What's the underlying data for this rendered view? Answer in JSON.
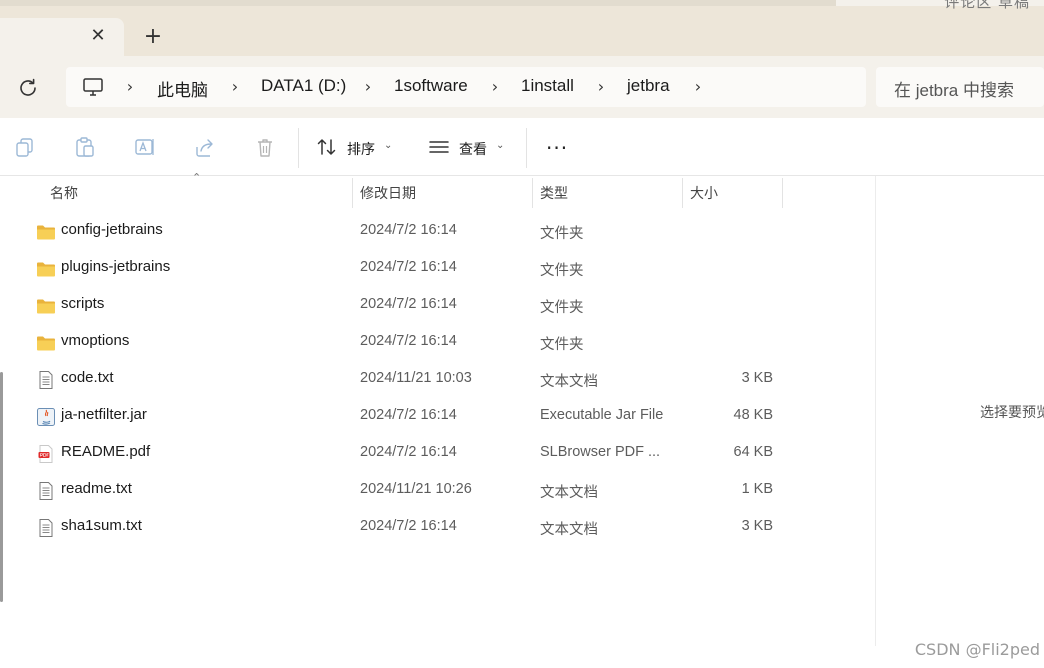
{
  "titlebar": {
    "corner_text": "评论区 草稿"
  },
  "tab": {
    "close_glyph": "✕",
    "new_tab_glyph": "+"
  },
  "address": {
    "breadcrumb": [
      "此电脑",
      "DATA1 (D:)",
      "1software",
      "1install",
      "jetbra"
    ],
    "chevron": "›",
    "search_placeholder": "在 jetbra 中搜索"
  },
  "toolbar": {
    "icons": [
      "copy-icon",
      "paste-icon",
      "rename-icon",
      "share-icon",
      "delete-icon"
    ],
    "sort_label": "排序",
    "view_label": "查看",
    "more_label": "···",
    "caret": "⌄"
  },
  "columns": {
    "name": "名称",
    "modified": "修改日期",
    "type": "类型",
    "size": "大小",
    "sort_indicator": "⌃"
  },
  "files": [
    {
      "name": "config-jetbrains",
      "modified": "2024/7/2 16:14",
      "type": "文件夹",
      "size": "",
      "icon": "folder-icon"
    },
    {
      "name": "plugins-jetbrains",
      "modified": "2024/7/2 16:14",
      "type": "文件夹",
      "size": "",
      "icon": "folder-icon"
    },
    {
      "name": "scripts",
      "modified": "2024/7/2 16:14",
      "type": "文件夹",
      "size": "",
      "icon": "folder-icon"
    },
    {
      "name": "vmoptions",
      "modified": "2024/7/2 16:14",
      "type": "文件夹",
      "size": "",
      "icon": "folder-icon"
    },
    {
      "name": "code.txt",
      "modified": "2024/11/21 10:03",
      "type": "文本文档",
      "size": "3 KB",
      "icon": "text-file-icon"
    },
    {
      "name": "ja-netfilter.jar",
      "modified": "2024/7/2 16:14",
      "type": "Executable Jar File",
      "size": "48 KB",
      "icon": "java-jar-icon"
    },
    {
      "name": "README.pdf",
      "modified": "2024/7/2 16:14",
      "type": "SLBrowser PDF ...",
      "size": "64 KB",
      "icon": "pdf-file-icon"
    },
    {
      "name": "readme.txt",
      "modified": "2024/11/21 10:26",
      "type": "文本文档",
      "size": "1 KB",
      "icon": "text-file-icon"
    },
    {
      "name": "sha1sum.txt",
      "modified": "2024/7/2 16:14",
      "type": "文本文档",
      "size": "3 KB",
      "icon": "text-file-icon"
    }
  ],
  "preview": {
    "text": "选择要预览"
  },
  "watermark": "CSDN @Fli2ped",
  "colors": {
    "folder": "#f4c84c",
    "titlebar": "#ede6d9",
    "addressbar": "#f4f1eb"
  }
}
